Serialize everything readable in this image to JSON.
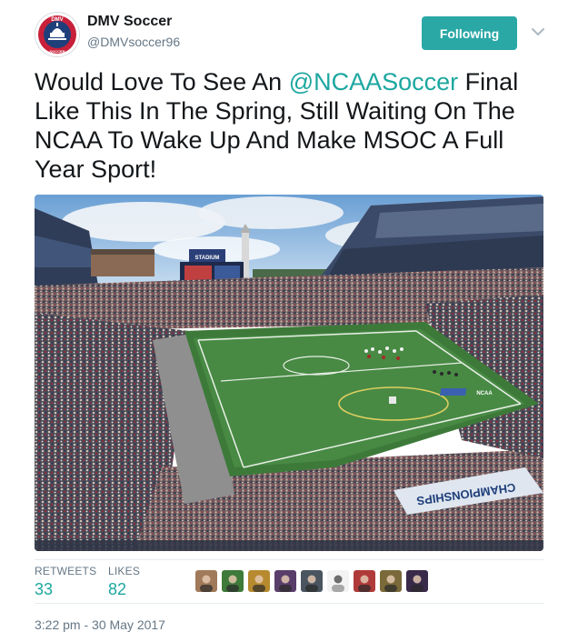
{
  "account": {
    "display_name": "DMV Soccer",
    "handle": "@DMVsoccer96",
    "avatar_text_top": "DMV",
    "avatar_text_bottom": "SOCCER"
  },
  "follow_button": {
    "label": "Following",
    "color": "#2aa8a6"
  },
  "tweet": {
    "text_before": "Would Love To See An ",
    "mention": "@NCAASoccer",
    "text_after": " Final Like This In The Spring, Still Waiting On The NCAA To Wake Up And Make MSOC A Full Year Sport!",
    "mention_color": "#1da7a0"
  },
  "photo": {
    "stadium_sign": "STADIUM",
    "banner_text": "CHAMPIONSHIPS",
    "logo_text": "NCAA"
  },
  "stats": {
    "retweets_label": "RETWEETS",
    "retweets_value": "33",
    "likes_label": "LIKES",
    "likes_value": "82"
  },
  "likers": [
    {
      "color": "#a07a5a",
      "icon": "person-avatar"
    },
    {
      "color": "#3e7a3a",
      "icon": "soccer-field-avatar"
    },
    {
      "color": "#b78a30",
      "icon": "badge-avatar"
    },
    {
      "color": "#5a3e6a",
      "icon": "person-avatar"
    },
    {
      "color": "#4a5560",
      "icon": "person-avatar"
    },
    {
      "color": "#f3f3f3",
      "icon": "logo-avatar"
    },
    {
      "color": "#b03a3a",
      "icon": "person-avatar"
    },
    {
      "color": "#7a6a3a",
      "icon": "field-avatar"
    },
    {
      "color": "#3a2a4a",
      "icon": "person-avatar"
    }
  ],
  "timestamp": "3:22 pm - 30 May 2017"
}
